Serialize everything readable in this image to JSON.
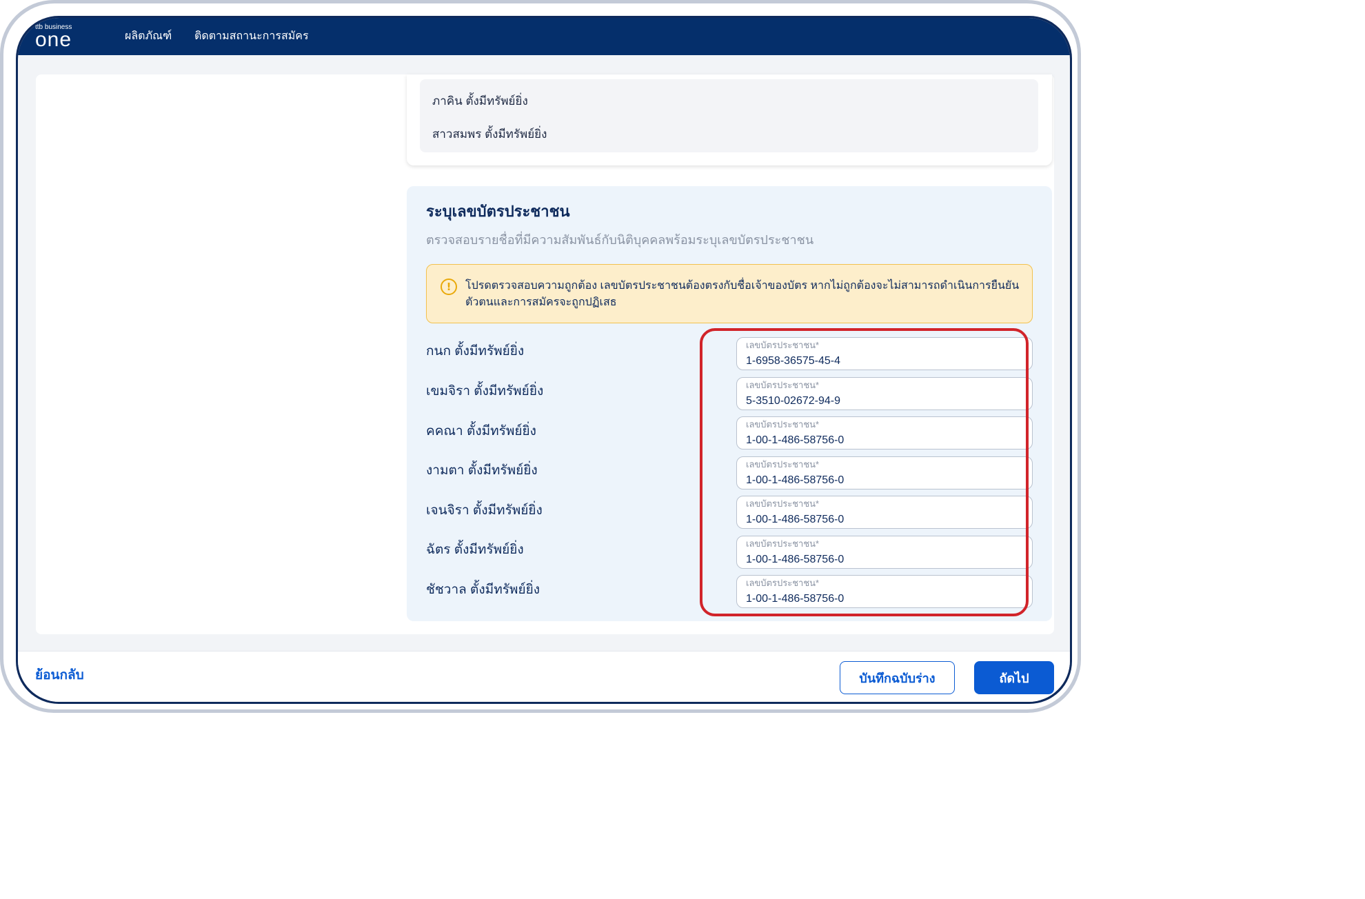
{
  "header": {
    "logo_small": "ttb business",
    "logo_big": "one",
    "nav": [
      "ผลิตภัณฑ์",
      "ติดตามสถานะการสมัคร"
    ]
  },
  "names_list": [
    "ภาคิน ตั้งมีทรัพย์ยิ่ง",
    "สาวสมพร ตั้งมีทรัพย์ยิ่ง"
  ],
  "id_section": {
    "title": "ระบุเลขบัตรประชาชน",
    "subtitle": "ตรวจสอบรายชื่อที่มีความสัมพันธ์กับนิติบุคคลพร้อมระบุเลขบัตรประชาชน",
    "warning_icon": "!",
    "warning": "โปรดตรวจสอบความถูกต้อง เลขบัตรประชาชนต้องตรงกับชื่อเจ้าของบัตร หากไม่ถูกต้องจะไม่สามารถดำเนินการยืนยันตัวตนและการสมัครจะถูกปฏิเสธ",
    "field_label": "เลขบัตรประชาชน*",
    "rows": [
      {
        "name": "กนก ตั้งมีทรัพย์ยิ่ง",
        "id": "1-6958-36575-45-4"
      },
      {
        "name": "เขมจิรา ตั้งมีทรัพย์ยิ่ง",
        "id": "5-3510-02672-94-9"
      },
      {
        "name": "คคณา ตั้งมีทรัพย์ยิ่ง",
        "id": "1-00-1-486-58756-0"
      },
      {
        "name": "งามตา ตั้งมีทรัพย์ยิ่ง",
        "id": "1-00-1-486-58756-0"
      },
      {
        "name": "เจนจิรา ตั้งมีทรัพย์ยิ่ง",
        "id": "1-00-1-486-58756-0"
      },
      {
        "name": "ฉัตร ตั้งมีทรัพย์ยิ่ง",
        "id": "1-00-1-486-58756-0"
      },
      {
        "name": "ชัชวาล ตั้งมีทรัพย์ยิ่ง",
        "id": "1-00-1-486-58756-0"
      }
    ]
  },
  "footer": {
    "back_label": "ย้อนกลับ",
    "draft_label": "บันทึกฉบับร่าง",
    "next_label": "ถัดไป"
  },
  "colors": {
    "header_bg": "#052f6b",
    "primary": "#0b5bd3",
    "highlight_border": "#d1242a",
    "warning_bg": "#fdeecb"
  }
}
